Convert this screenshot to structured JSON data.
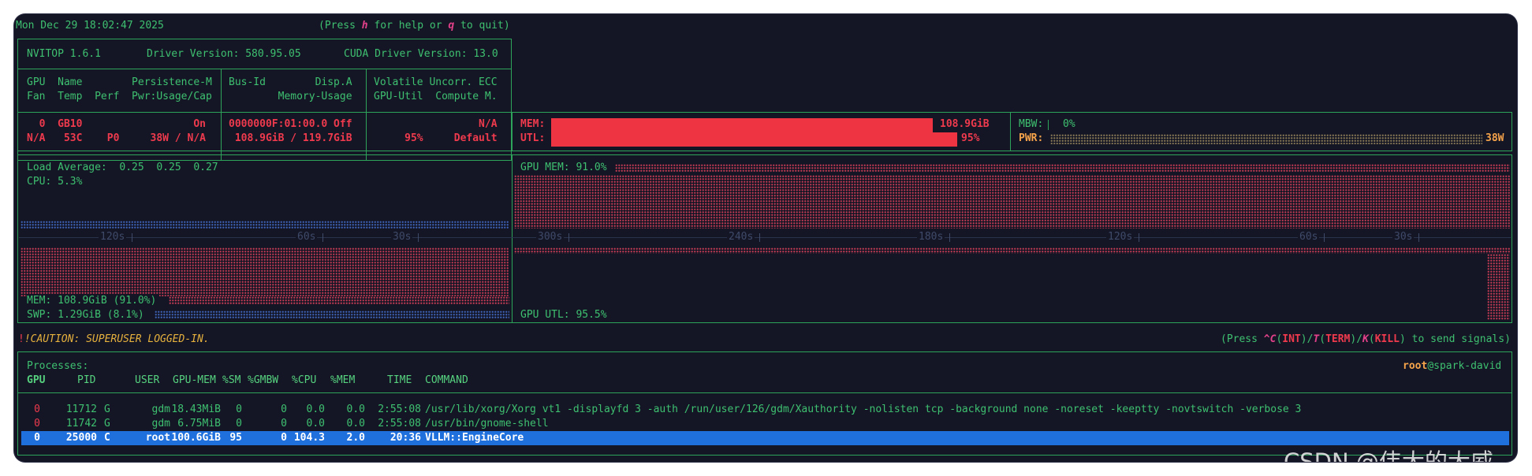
{
  "header": {
    "datetime": "Mon Dec 29 18:02:47 2025",
    "help_pre": "(Press ",
    "help_key": "h",
    "help_mid": " for help or ",
    "quit_key": "q",
    "help_post": " to quit)"
  },
  "info": {
    "version": "NVITOP 1.6.1",
    "driver": "Driver Version: 580.95.05",
    "cuda": "CUDA Driver Version: 13.0"
  },
  "gpu_header": {
    "row1_col1": "GPU  Name        Persistence-M",
    "row2_col1": "Fan  Temp  Perf  Pwr:Usage/Cap",
    "row1_col2": "Bus-Id        Disp.A",
    "row2_col2": "        Memory-Usage",
    "row1_col3": "Volatile Uncorr. ECC",
    "row2_col3": "GPU-Util  Compute M."
  },
  "gpu_row": {
    "row1_col1": "  0  GB10                  On",
    "row2_col1": "N/A   53C    P0     38W / N/A",
    "row1_col2": "0000000F:01:00.0 Off",
    "row2_col2": " 108.9GiB / 119.7GiB",
    "row1_col3": "                 N/A",
    "row2_col3": "     95%     Default",
    "mem_label": "MEM:",
    "mem_value": "108.9GiB",
    "mem_fraction": 0.91,
    "utl_label": "UTL:",
    "utl_value": "95%",
    "utl_fraction": 0.95,
    "mbw_label": "MBW:",
    "mbw_value": "0%",
    "pwr_label": "PWR:",
    "pwr_value": "38W"
  },
  "host": {
    "load_average": "Load Average:  0.25  0.25  0.27",
    "cpu": "CPU: 5.3%",
    "mem": "MEM: 108.9GiB (91.0%)",
    "swp": "SWP: 1.29GiB (8.1%)",
    "gpu_mem": "GPU MEM: 91.0%",
    "gpu_utl": "GPU UTL: 95.5%",
    "left_ticks": [
      "120s",
      "60s",
      "30s"
    ],
    "right_ticks": [
      "300s",
      "240s",
      "180s",
      "120s",
      "60s",
      "30s"
    ]
  },
  "caution": {
    "text": "!CAUTION: SUPERUSER LOGGED-IN.",
    "signals_pre": "(Press ",
    "int_key": "^C",
    "int_name": "INT",
    "term_key": "T",
    "term_name": "TERM",
    "kill_key": "K",
    "kill_name": "KILL",
    "signals_post": " to send signals)"
  },
  "processes": {
    "title": "Processes:",
    "user": "root",
    "host": "@spark-david",
    "columns": [
      "GPU",
      "PID",
      "USER",
      "GPU-MEM",
      "%SM",
      "%GMBW",
      "%CPU",
      "%MEM",
      "TIME",
      "COMMAND"
    ],
    "rows": [
      {
        "gpu": "0",
        "pid": "11712",
        "type": "G",
        "user": "gdm",
        "gpu_mem": "18.43MiB",
        "sm": "0",
        "gmbw": "0",
        "cpu": "0.0",
        "mem": "0.0",
        "time": "2:55:08",
        "command": "/usr/lib/xorg/Xorg vt1 -displayfd 3 -auth /run/user/126/gdm/Xauthority -nolisten tcp -background none -noreset -keeptty -novtswitch -verbose 3"
      },
      {
        "gpu": "0",
        "pid": "11742",
        "type": "G",
        "user": "gdm",
        "gpu_mem": "6.75MiB",
        "sm": "0",
        "gmbw": "0",
        "cpu": "0.0",
        "mem": "0.0",
        "time": "2:55:08",
        "command": "/usr/bin/gnome-shell"
      },
      {
        "gpu": "0",
        "pid": "25000",
        "type": "C",
        "user": "root",
        "gpu_mem": "100.6GiB",
        "sm": "95",
        "gmbw": "0",
        "cpu": "104.3",
        "mem": "2.0",
        "time": "20:36",
        "command": "VLLM::EngineCore"
      }
    ]
  },
  "watermark": "CSDN @伟大的大威",
  "colors": {
    "background": "#141625",
    "border_green": "#2ea35a",
    "text_green": "#3ec070",
    "alert_red": "#ef3a4d",
    "bar_red": "#ee3342",
    "accent_orange": "#f7a44b",
    "caution_yellow": "#e6b13d",
    "key_magenta": "#e2418a",
    "selected_row_blue": "#1f6fdc"
  }
}
